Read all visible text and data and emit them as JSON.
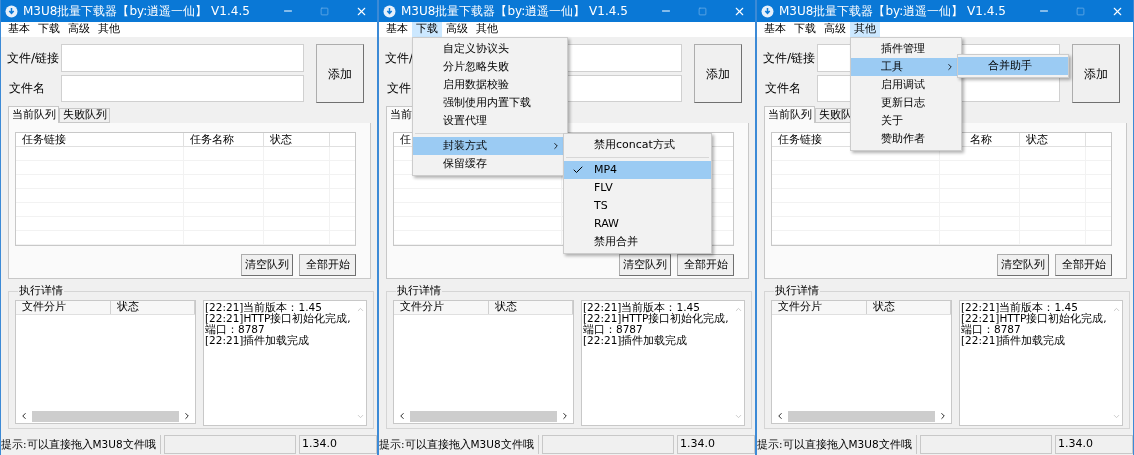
{
  "windows": [
    {
      "title": "M3U8批量下载器【by:逍遥一仙】 V1.4.5",
      "menubar": [
        {
          "label": "基本",
          "selected": false
        },
        {
          "label": "下载",
          "selected": false
        },
        {
          "label": "高级",
          "selected": false
        },
        {
          "label": "其他",
          "selected": false
        }
      ],
      "fields": [
        {
          "label": "文件/链接"
        },
        {
          "label": "文件名"
        }
      ],
      "add_button": "添加",
      "tabs": [
        {
          "label": "当前队列",
          "selected": true
        },
        {
          "label": "失败队列",
          "selected": false
        }
      ],
      "queue_columns": [
        {
          "label": "任务链接",
          "cut": false
        },
        {
          "label": "任务名称",
          "cut": false
        },
        {
          "label": "状态",
          "cut": false
        }
      ],
      "queue_buttons": [
        "清空队列",
        "全部开始"
      ],
      "details": {
        "title": "执行详情",
        "columns": [
          "文件分片",
          "状态"
        ],
        "log": [
          "[22:21]当前版本：1.45",
          "[22:21]HTTP接口初始化完成,端口：8787",
          "[22:21]插件加载完成"
        ]
      },
      "status_bar": {
        "hint": "提示:可以直接拖入M3U8文件哦",
        "version": "1.34.0"
      }
    },
    {
      "title": "M3U8批量下载器【by:逍遥一仙】 V1.4.5",
      "menubar": [
        {
          "label": "基本",
          "selected": false
        },
        {
          "label": "下载",
          "selected": true,
          "items": [
            {
              "label": "自定义协议头",
              "selected": false,
              "separator_before": false
            },
            {
              "label": "分片忽略失败",
              "selected": false,
              "separator_before": false
            },
            {
              "label": "启用数据校验",
              "selected": false,
              "separator_before": false
            },
            {
              "label": "强制使用内置下载",
              "selected": false,
              "separator_before": false
            },
            {
              "label": "设置代理",
              "selected": false,
              "separator_before": false
            },
            {
              "label": "封装方式",
              "selected": true,
              "separator_before": true,
              "items": [
                {
                  "label": "禁用concat方式",
                  "selected": false,
                  "checked": false,
                  "separator_before": false
                },
                {
                  "label": "MP4",
                  "selected": true,
                  "checked": true,
                  "separator_before": true
                },
                {
                  "label": "FLV",
                  "selected": false,
                  "checked": false,
                  "separator_before": false
                },
                {
                  "label": "TS",
                  "selected": false,
                  "checked": false,
                  "separator_before": false
                },
                {
                  "label": "RAW",
                  "selected": false,
                  "checked": false,
                  "separator_before": false
                },
                {
                  "label": "禁用合并",
                  "selected": false,
                  "checked": false,
                  "separator_before": false
                }
              ]
            },
            {
              "label": "保留缓存",
              "selected": false,
              "separator_before": false
            }
          ]
        },
        {
          "label": "高级",
          "selected": false
        },
        {
          "label": "其他",
          "selected": false
        }
      ],
      "fields": [
        {
          "label": "文件/"
        },
        {
          "label": "文件"
        }
      ],
      "add_button": "添加",
      "tabs": [
        {
          "label": "当前",
          "selected": true
        }
      ],
      "queue_columns": [
        {
          "label": "任",
          "cut": false
        }
      ],
      "queue_buttons": [
        "清空队列",
        "全部开始"
      ],
      "details": {
        "title": "执行详情",
        "columns": [
          "文件分片",
          "状态"
        ],
        "log": [
          "[22:21]当前版本：1.45",
          "[22:21]HTTP接口初始化完成,端口：8787",
          "[22:21]插件加载完成"
        ]
      },
      "status_bar": {
        "hint": "提示:可以直接拖入M3U8文件哦",
        "version": "1.34.0"
      }
    },
    {
      "title": "M3U8批量下载器【by:逍遥一仙】 V1.4.5",
      "menubar": [
        {
          "label": "基本",
          "selected": false
        },
        {
          "label": "下载",
          "selected": false
        },
        {
          "label": "高级",
          "selected": false
        },
        {
          "label": "其他",
          "selected": true,
          "items": [
            {
              "label": "插件管理",
              "selected": false,
              "separator_before": false
            },
            {
              "label": "工具",
              "selected": true,
              "separator_before": false,
              "items": [
                {
                  "label": "合并助手",
                  "selected": true,
                  "separator_before": false
                }
              ]
            },
            {
              "label": "启用调试",
              "selected": false,
              "separator_before": false
            },
            {
              "label": "更新日志",
              "selected": false,
              "separator_before": false
            },
            {
              "label": "关于",
              "selected": false,
              "separator_before": false
            },
            {
              "label": "赞助作者",
              "selected": false,
              "separator_before": false
            }
          ]
        }
      ],
      "fields": [
        {
          "label": "文件/链接"
        },
        {
          "label": "文件名"
        }
      ],
      "add_button": "添加",
      "tabs": [
        {
          "label": "当前队列",
          "selected": true
        },
        {
          "label": "失败队",
          "selected": false
        }
      ],
      "queue_columns": [
        {
          "label": "任务链接",
          "cut": false
        },
        {
          "label": "名称",
          "cut": true
        },
        {
          "label": "状态",
          "cut": false
        }
      ],
      "queue_buttons": [
        "清空队列",
        "全部开始"
      ],
      "details": {
        "title": "执行详情",
        "columns": [
          "文件分片",
          "状态"
        ],
        "log": [
          "[22:21]当前版本：1.45",
          "[22:21]HTTP接口初始化完成,端口：8787",
          "[22:21]插件加载完成"
        ]
      },
      "status_bar": {
        "hint": "提示:可以直接拖入M3U8文件哦",
        "version": "1.34.0"
      }
    }
  ]
}
